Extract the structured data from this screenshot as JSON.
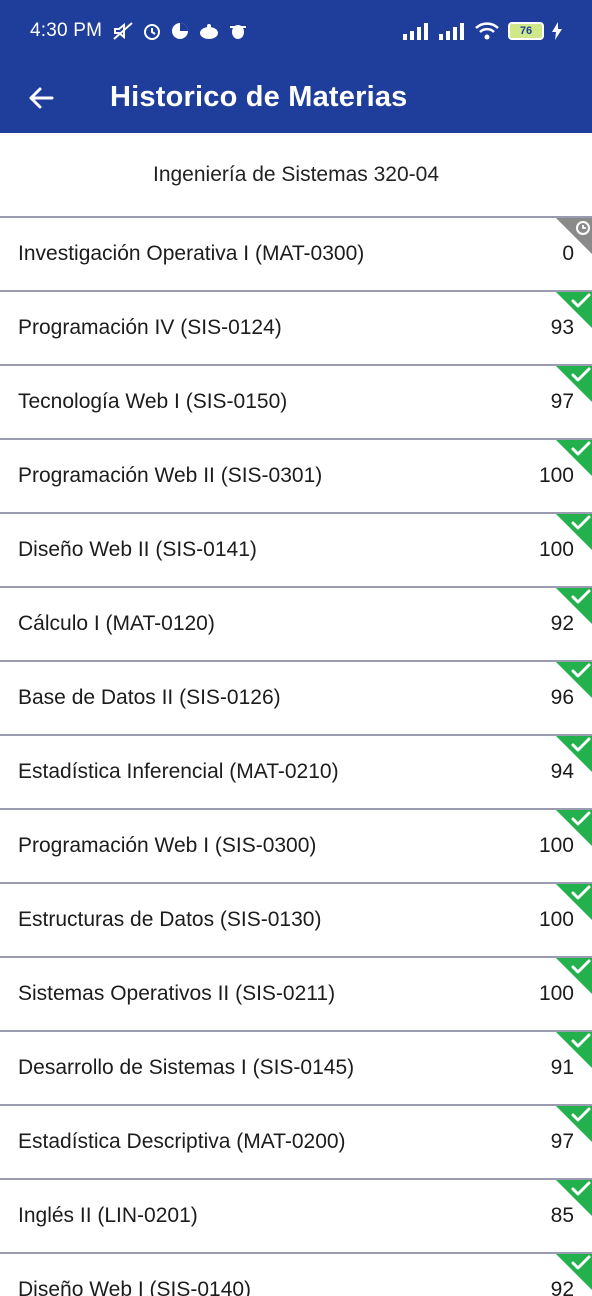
{
  "status_bar": {
    "time": "4:30 PM",
    "battery": "76",
    "icons": [
      "mute-icon",
      "alarm-icon",
      "app-icon",
      "cloud-icon",
      "bug-icon",
      "signal-icon",
      "signal-icon",
      "wifi-icon",
      "battery-icon",
      "charging-icon"
    ]
  },
  "app_bar": {
    "title": "Historico de Materias",
    "back_icon": "arrow-left-icon"
  },
  "career": "Ingeniería de Sistemas 320-04",
  "colors": {
    "primary": "#1f3d9a",
    "approved": "#22b14c",
    "pending": "#8a8a8a",
    "divider": "#9a9ab0"
  },
  "subjects": [
    {
      "name": "Investigación Operativa I (MAT-0300)",
      "grade": "0",
      "status": "pending"
    },
    {
      "name": "Programación IV (SIS-0124)",
      "grade": "93",
      "status": "approved"
    },
    {
      "name": "Tecnología Web I (SIS-0150)",
      "grade": "97",
      "status": "approved"
    },
    {
      "name": "Programación Web II (SIS-0301)",
      "grade": "100",
      "status": "approved"
    },
    {
      "name": "Diseño Web II (SIS-0141)",
      "grade": "100",
      "status": "approved"
    },
    {
      "name": "Cálculo I (MAT-0120)",
      "grade": "92",
      "status": "approved"
    },
    {
      "name": "Base de Datos II (SIS-0126)",
      "grade": "96",
      "status": "approved"
    },
    {
      "name": "Estadística Inferencial (MAT-0210)",
      "grade": "94",
      "status": "approved"
    },
    {
      "name": "Programación Web I (SIS-0300)",
      "grade": "100",
      "status": "approved"
    },
    {
      "name": "Estructuras de Datos (SIS-0130)",
      "grade": "100",
      "status": "approved"
    },
    {
      "name": "Sistemas Operativos II (SIS-0211)",
      "grade": "100",
      "status": "approved"
    },
    {
      "name": "Desarrollo de Sistemas I (SIS-0145)",
      "grade": "91",
      "status": "approved"
    },
    {
      "name": "Estadística Descriptiva (MAT-0200)",
      "grade": "97",
      "status": "approved"
    },
    {
      "name": "Inglés II (LIN-0201)",
      "grade": "85",
      "status": "approved"
    },
    {
      "name": "Diseño Web I (SIS-0140)",
      "grade": "92",
      "status": "approved"
    }
  ]
}
